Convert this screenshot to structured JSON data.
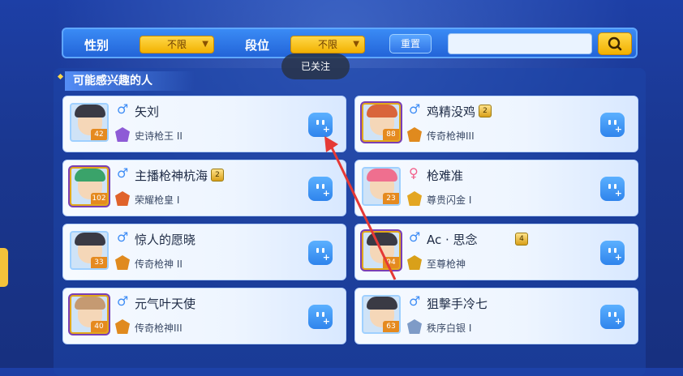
{
  "filters": {
    "gender_label": "性别",
    "gender_value": "不限",
    "rank_label": "段位",
    "rank_value": "不限",
    "reset_label": "重置",
    "search_value": "",
    "search_placeholder": ""
  },
  "toast": "已关注",
  "section_title": "可能感兴趣的人",
  "players": [
    {
      "name": "矢刘",
      "gender": "♂",
      "gender_type": "m",
      "level": "42",
      "rank": "史诗枪王 II",
      "rank_color": "#8e5bd6",
      "has_title_badge": false,
      "title_badge": "",
      "hair": "#3a3a44",
      "gold": false
    },
    {
      "name": "鸡精没鸡",
      "gender": "♂",
      "gender_type": "m",
      "level": "88",
      "rank": "传奇枪神III",
      "rank_color": "#e08a1e",
      "has_title_badge": true,
      "title_badge": "2",
      "hair": "#d9653a",
      "gold": true
    },
    {
      "name": "主播枪神杭海",
      "gender": "♂",
      "gender_type": "m",
      "level": "102",
      "rank": "荣耀枪皇 I",
      "rank_color": "#e0632a",
      "has_title_badge": true,
      "title_badge": "2",
      "hair": "#3aa36a",
      "gold": true
    },
    {
      "name": "枪难准",
      "gender": "♀",
      "gender_type": "f",
      "level": "23",
      "rank": "尊贵闪金 I",
      "rank_color": "#e3a622",
      "has_title_badge": false,
      "title_badge": "",
      "hair": "#ef6f8f",
      "gold": false
    },
    {
      "name": "惊人的愿晓",
      "gender": "♂",
      "gender_type": "m",
      "level": "33",
      "rank": "传奇枪神 II",
      "rank_color": "#e08a1e",
      "has_title_badge": false,
      "title_badge": "",
      "hair": "#3a3a44",
      "gold": false
    },
    {
      "name": "Ac · 思念",
      "gender": "♂",
      "gender_type": "m",
      "level": "94",
      "rank": "至尊枪神",
      "rank_color": "#d9a019",
      "has_title_badge": true,
      "title_badge": "4",
      "hair": "#3a3a44",
      "gold": true
    },
    {
      "name": "元气叶天使",
      "gender": "♂",
      "gender_type": "m",
      "level": "40",
      "rank": "传奇枪神III",
      "rank_color": "#e08a1e",
      "has_title_badge": false,
      "title_badge": "",
      "hair": "#c59a72",
      "gold": true
    },
    {
      "name": "狙擊手冷七",
      "gender": "♂",
      "gender_type": "m",
      "level": "63",
      "rank": "秩序白银 I",
      "rank_color": "#7e9bc7",
      "has_title_badge": false,
      "title_badge": "",
      "hair": "#3a3a44",
      "gold": false
    }
  ],
  "colors": {
    "accent": "#2f84ec",
    "gold": "#f2b100",
    "arrow": "#e53935"
  }
}
